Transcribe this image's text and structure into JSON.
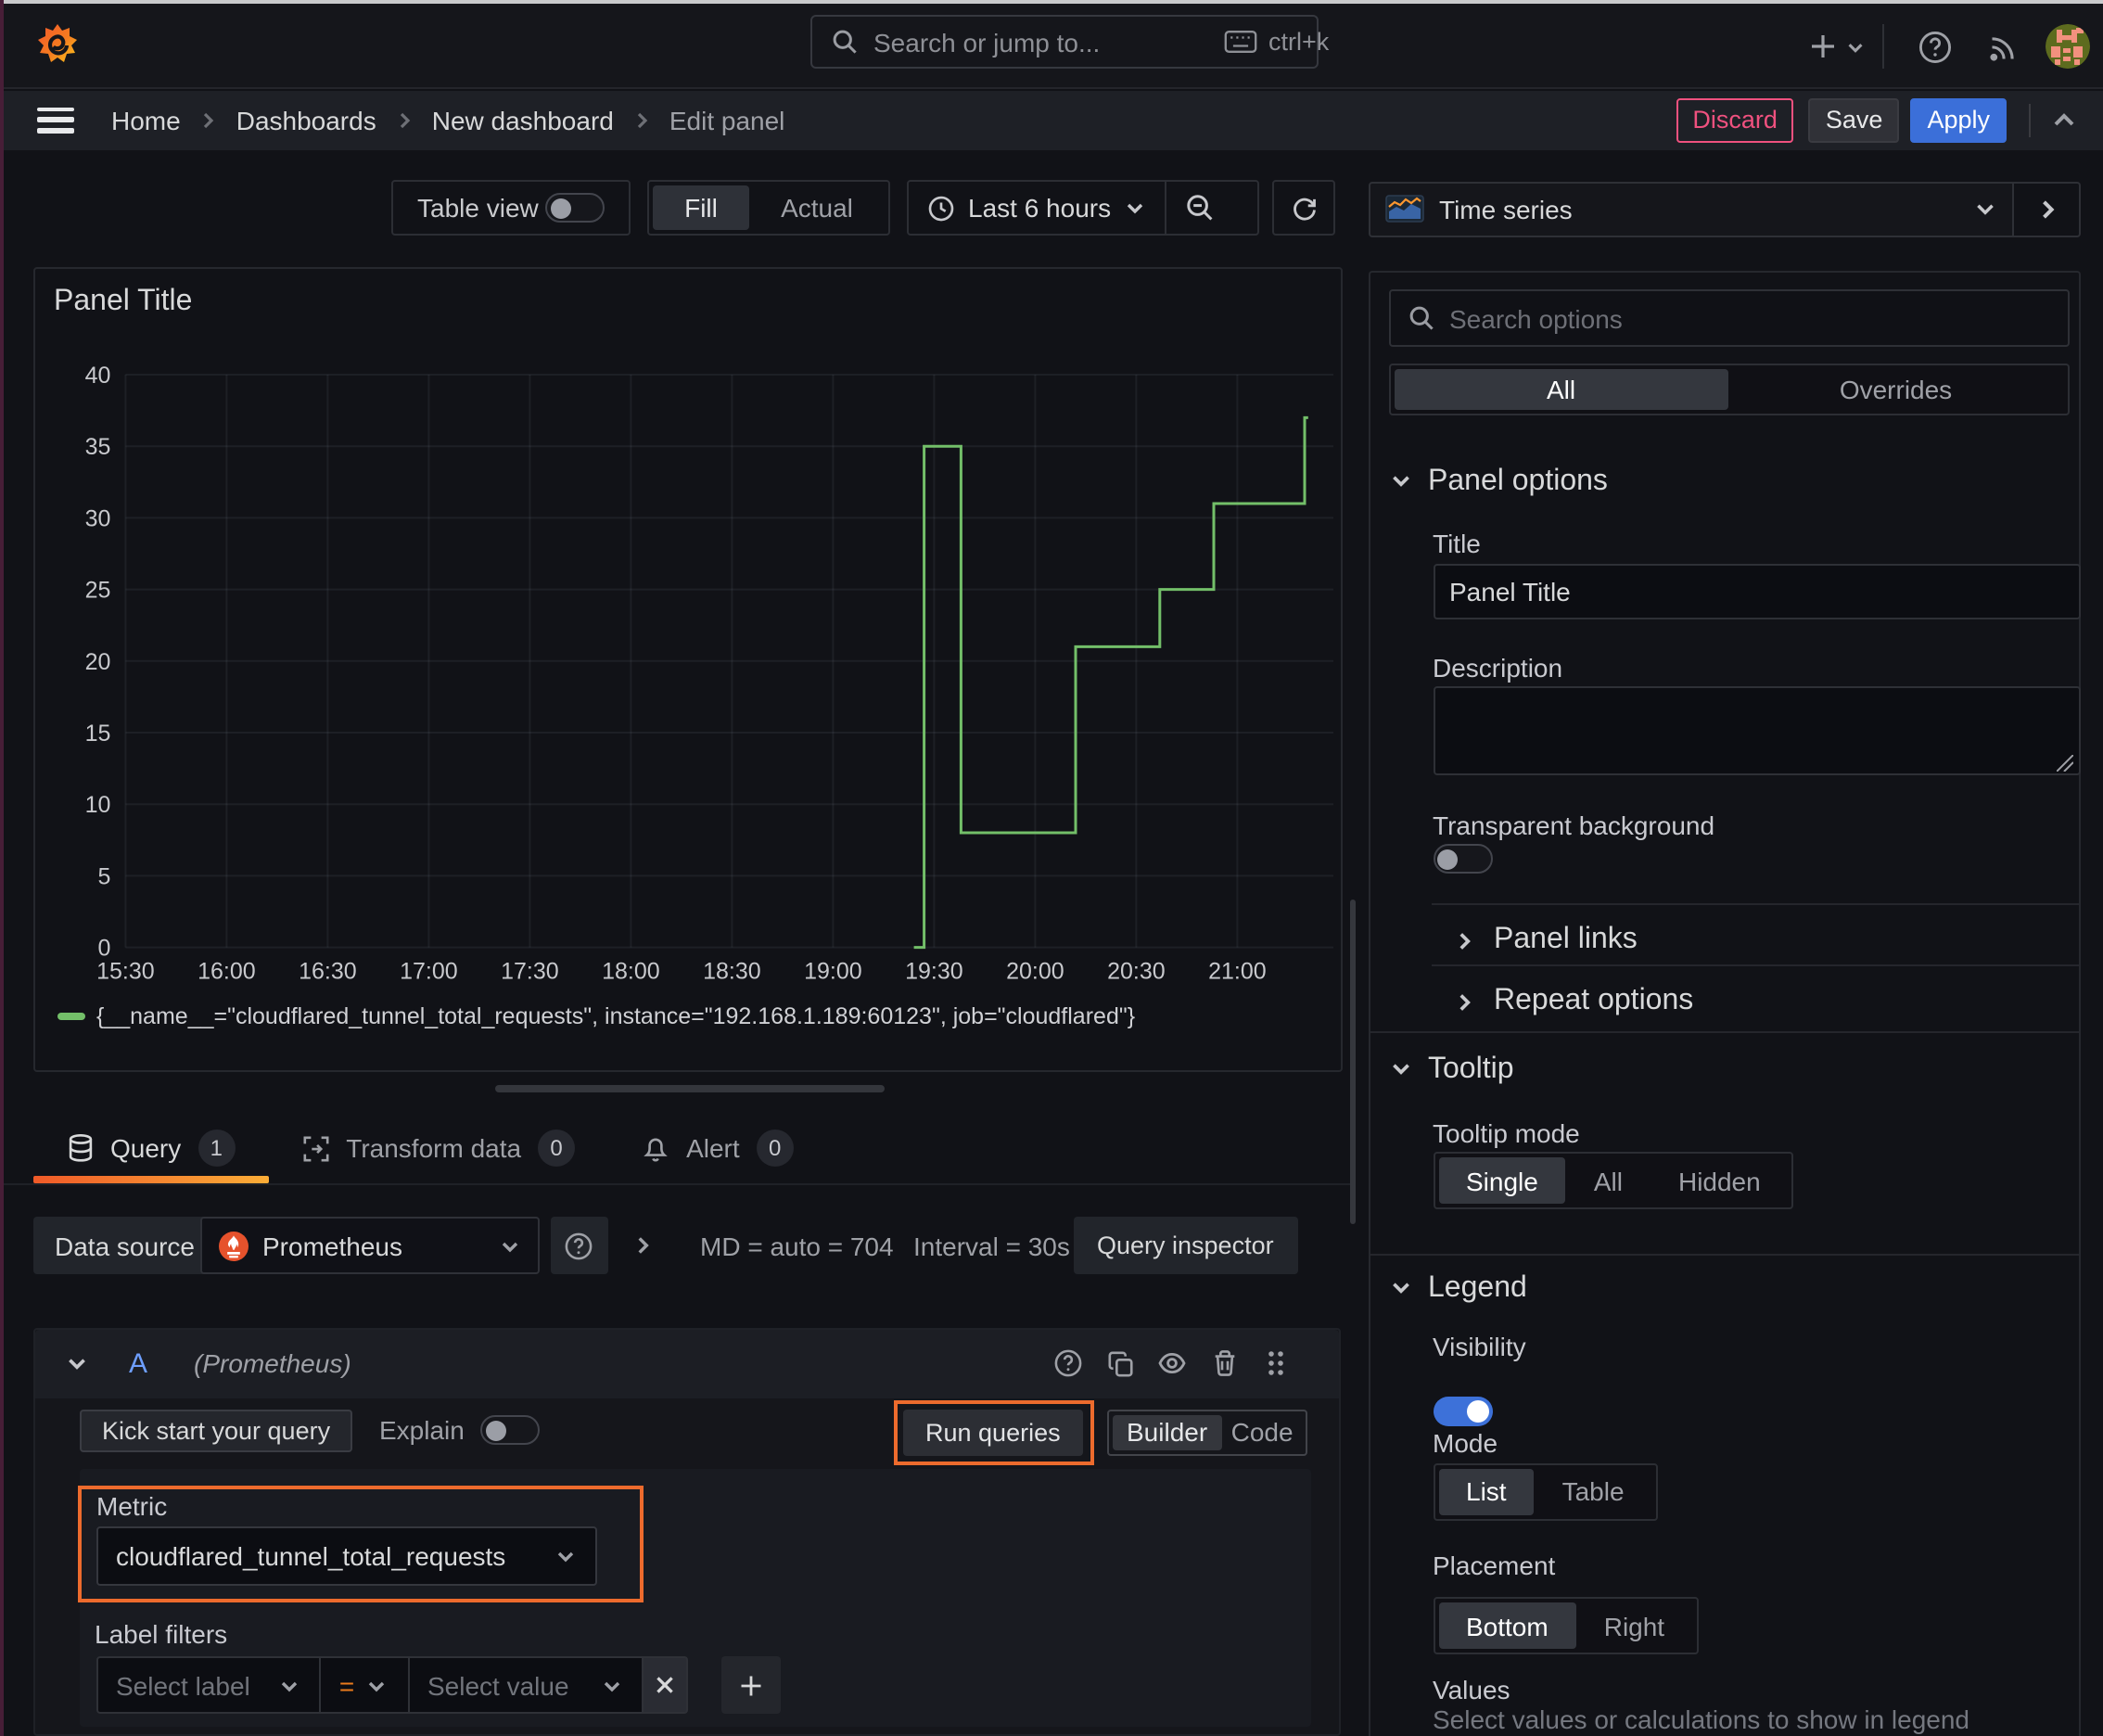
{
  "window": {
    "top_strip_color": "#c9cacc",
    "left_strip_color": "#471e37"
  },
  "topbar": {
    "search_placeholder": "Search or jump to...",
    "search_shortcut": "ctrl+k"
  },
  "breadcrumbs": [
    {
      "label": "Home"
    },
    {
      "label": "Dashboards"
    },
    {
      "label": "New dashboard"
    },
    {
      "label": "Edit panel"
    }
  ],
  "actions": {
    "discard": "Discard",
    "save": "Save",
    "apply": "Apply"
  },
  "toolbar": {
    "table_view_label": "Table view",
    "fill_label": "Fill",
    "actual_label": "Actual",
    "time_range_label": "Last 6 hours"
  },
  "viz_picker": {
    "label": "Time series"
  },
  "panel": {
    "title": "Panel Title"
  },
  "chart_data": {
    "type": "line",
    "line_style": "step-after",
    "color": "#73bf69",
    "title": "Panel Title",
    "xlabel": "",
    "ylabel": "",
    "x_ticks": [
      "15:30",
      "16:00",
      "16:30",
      "17:00",
      "17:30",
      "18:00",
      "18:30",
      "19:00",
      "19:30",
      "20:00",
      "20:30",
      "21:00"
    ],
    "y_ticks": [
      0,
      5,
      10,
      15,
      20,
      25,
      30,
      35,
      40
    ],
    "ylim": [
      0,
      40
    ],
    "x_start": "15:30",
    "x_end": "21:22",
    "grid": true,
    "legend_position": "bottom",
    "series": [
      {
        "name": "{__name__=\"cloudflared_tunnel_total_requests\", instance=\"192.168.1.189:60123\", job=\"cloudflared\"}",
        "points": [
          {
            "t": "19:24",
            "v": 0
          },
          {
            "t": "19:27",
            "v": 35
          },
          {
            "t": "19:38",
            "v": 8
          },
          {
            "t": "20:12",
            "v": 21
          },
          {
            "t": "20:37",
            "v": 25
          },
          {
            "t": "20:53",
            "v": 31
          },
          {
            "t": "21:20",
            "v": 37
          }
        ],
        "end": "21:21"
      }
    ]
  },
  "tabs": [
    {
      "label": "Query",
      "count": "1",
      "active": true
    },
    {
      "label": "Transform data",
      "count": "0",
      "active": false
    },
    {
      "label": "Alert",
      "count": "0",
      "active": false
    }
  ],
  "datasource_row": {
    "label": "Data source",
    "value": "Prometheus",
    "stats_md": "MD = auto = 704",
    "stats_interval": "Interval = 30s",
    "inspector_label": "Query inspector"
  },
  "query_row": {
    "ref_id": "A",
    "datasource_hint": "(Prometheus)",
    "kick_start_label": "Kick start your query",
    "explain_label": "Explain",
    "run_queries_label": "Run queries",
    "builder_label": "Builder",
    "code_label": "Code",
    "metric_label": "Metric",
    "metric_value": "cloudflared_tunnel_total_requests",
    "label_filters_label": "Label filters",
    "select_label_placeholder": "Select label",
    "operator": "=",
    "select_value_placeholder": "Select value"
  },
  "annotations": {
    "color": "#ed6b2d"
  },
  "options_pane": {
    "search_placeholder": "Search options",
    "filter_tabs": {
      "all": "All",
      "overrides": "Overrides"
    },
    "panel_options": {
      "title": "Panel options",
      "title_label": "Title",
      "title_value": "Panel Title",
      "description_label": "Description",
      "transparent_label": "Transparent background",
      "links_label": "Panel links",
      "repeat_label": "Repeat options"
    },
    "tooltip": {
      "title": "Tooltip",
      "mode_label": "Tooltip mode",
      "options": [
        "Single",
        "All",
        "Hidden"
      ],
      "selected": "Single"
    },
    "legend": {
      "title": "Legend",
      "visibility_label": "Visibility",
      "mode_label": "Mode",
      "mode_options": [
        "List",
        "Table"
      ],
      "mode_selected": "List",
      "placement_label": "Placement",
      "placement_options": [
        "Bottom",
        "Right"
      ],
      "placement_selected": "Bottom",
      "values_label": "Values",
      "values_placeholder": "Select values or calculations to show in legend"
    }
  }
}
